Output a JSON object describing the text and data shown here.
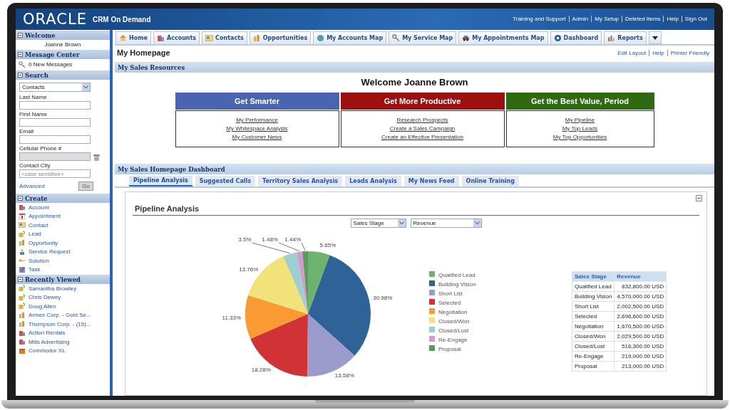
{
  "header": {
    "logo": "ORACLE",
    "product": "CRM On Demand",
    "links": [
      "Training and Support",
      "Admin",
      "My Setup",
      "Deleted Items",
      "Help",
      "Sign Out"
    ]
  },
  "sidebar": {
    "welcome": {
      "title": "Welcome",
      "name": "Joanne Brown"
    },
    "message_center": {
      "title": "Message Center",
      "messages": "0 New Messages"
    },
    "search": {
      "title": "Search",
      "record_type": "Contacts",
      "fields": [
        {
          "label": "Last Name",
          "disabled": false
        },
        {
          "label": "First Name",
          "disabled": false
        },
        {
          "label": "Email",
          "disabled": false
        },
        {
          "label": "Cellular Phone #",
          "disabled": true
        },
        {
          "label": "Contact City",
          "placeholder": "<case sensitive>",
          "disabled": false
        }
      ],
      "advanced_link": "Advanced",
      "go_button": {
        "label": "Go",
        "disabled": true
      }
    },
    "create": {
      "title": "Create",
      "items": [
        {
          "label": "Account",
          "kind": "account"
        },
        {
          "label": "Appointment",
          "kind": "appointment"
        },
        {
          "label": "Contact",
          "kind": "contact"
        },
        {
          "label": "Lead",
          "kind": "lead"
        },
        {
          "label": "Opportunity",
          "kind": "opportunity"
        },
        {
          "label": "Service Request",
          "kind": "service-request"
        },
        {
          "label": "Solution",
          "kind": "solution"
        },
        {
          "label": "Task",
          "kind": "task"
        }
      ]
    },
    "recently_viewed": {
      "title": "Recently Viewed",
      "items": [
        {
          "label": "Samantha Browley",
          "kind": "lead"
        },
        {
          "label": "Chris Dewey",
          "kind": "lead"
        },
        {
          "label": "Doug Allen",
          "kind": "lead"
        },
        {
          "label": "Armex Corp. - Gold Se...",
          "kind": "opportunity"
        },
        {
          "label": "Thompson Corp. - (15)...",
          "kind": "opportunity"
        },
        {
          "label": "Action Rentals",
          "kind": "account"
        },
        {
          "label": "Mills Advertising",
          "kind": "account"
        },
        {
          "label": "Commodor XL",
          "kind": "product"
        }
      ]
    }
  },
  "tabs": [
    {
      "label": "Home",
      "kind": "home",
      "selected": false
    },
    {
      "label": "Accounts",
      "kind": "account",
      "selected": false
    },
    {
      "label": "Contacts",
      "kind": "contact",
      "selected": false
    },
    {
      "label": "Opportunities",
      "kind": "opportunity",
      "selected": false
    },
    {
      "label": "My Accounts Map",
      "kind": "globe",
      "selected": false
    },
    {
      "label": "My Service Map",
      "kind": "key",
      "selected": false
    },
    {
      "label": "My Appointments Map",
      "kind": "car",
      "selected": false
    },
    {
      "label": "Dashboard",
      "kind": "dashboard",
      "selected": false
    },
    {
      "label": "Reports",
      "kind": "reports",
      "selected": false
    }
  ],
  "page_title": "My Homepage",
  "page_links": [
    "Edit Layout",
    "Help",
    "Printer Friendly"
  ],
  "sales_resources": {
    "title": "My Sales Resources",
    "welcome": "Welcome Joanne Brown",
    "columns": [
      {
        "heading": "Get Smarter",
        "color": "#4a64b0",
        "links": [
          "My Performance",
          "My Whitespace Analysis",
          "My Customer News"
        ]
      },
      {
        "heading": "Get More Productive",
        "color": "#9c1010",
        "links": [
          "Research Prospects",
          "Create a Sales Campaign",
          "Create an Effective Presentation"
        ]
      },
      {
        "heading": "Get the Best Value, Period",
        "color": "#2e6a10",
        "links": [
          "My Pipeline",
          "My Top Leads",
          "My Top Opportunities"
        ]
      }
    ]
  },
  "dashboard": {
    "title": "My Sales Homepage Dashboard",
    "tabs": [
      {
        "label": "Pipeline Analysis",
        "selected": true
      },
      {
        "label": "Suggested Calls",
        "selected": false
      },
      {
        "label": "Territory Sales Analysis",
        "selected": false
      },
      {
        "label": "Leads Analysis",
        "selected": false
      },
      {
        "label": "My News Feed",
        "selected": false
      },
      {
        "label": "Online Training",
        "selected": false
      }
    ],
    "panel": {
      "title": "Pipeline Analysis",
      "selects": [
        "Sales Stage",
        "Revenue"
      ],
      "chart_data": {
        "type": "pie",
        "legend": "right",
        "categories": [
          "Qualified Lead",
          "Building Vision",
          "Short List",
          "Selected",
          "Negotiation",
          "Closed/Won",
          "Closed/Lost",
          "Re-Engage",
          "Proposal"
        ],
        "values": [
          5.65,
          30.98,
          13.58,
          18.28,
          11.33,
          13.76,
          3.5,
          1.48,
          1.44
        ],
        "colors": [
          "#6db36d",
          "#2f6296",
          "#9b9bcc",
          "#d03236",
          "#f99a32",
          "#f2e27a",
          "#9dcfd1",
          "#d69ad0",
          "#5a9a5a"
        ],
        "value_labels": [
          "5.65%",
          "30.98%",
          "13.58%",
          "18.28%",
          "11.33%",
          "13.76%",
          "3.5%",
          "1.48%",
          "1.44%"
        ]
      },
      "table": {
        "columns": [
          "Sales Stage",
          "Revenue"
        ],
        "rows": [
          [
            "Qualified Lead",
            "832,800.00 USD"
          ],
          [
            "Building Vision",
            "4,570,000.00 USD"
          ],
          [
            "Short List",
            "2,002,500.00 USD"
          ],
          [
            "Selected",
            "2,696,600.00 USD"
          ],
          [
            "Negotiation",
            "1,670,500.00 USD"
          ],
          [
            "Closed/Won",
            "2,029,500.00 USD"
          ],
          [
            "Closed/Lost",
            "516,300.00 USD"
          ],
          [
            "Re-Engage",
            "219,000.00 USD"
          ],
          [
            "Proposal",
            "213,000.00 USD"
          ]
        ]
      }
    }
  }
}
